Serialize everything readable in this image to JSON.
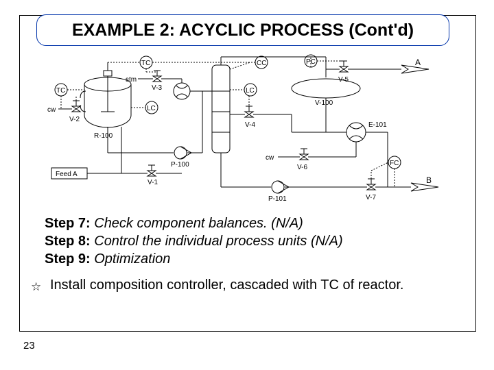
{
  "title": "EXAMPLE 2: ACYCLIC PROCESS (Cont'd)",
  "diagram": {
    "reactor": "R-100",
    "pump1": "P-100",
    "pump2": "P-101",
    "exchanger": "E-101",
    "valves": [
      "V-1",
      "V-2",
      "V-3",
      "V-4",
      "V-5",
      "V-6",
      "V-7",
      "V-100"
    ],
    "controllers": [
      "TC",
      "TC",
      "LC",
      "LC",
      "PC",
      "CC",
      "FC"
    ],
    "streams": [
      "Feed A",
      "cw",
      "stm",
      "cw",
      "A",
      "B"
    ],
    "product_A": "A",
    "product_B": "B",
    "feed": "Feed A",
    "cw": "cw",
    "stm": "stm"
  },
  "steps": {
    "s7_label": "Step 7:",
    "s7_text": " Check component balances. (N/A)",
    "s8_label": "Step 8:",
    "s8_text": " Control the individual process units (N/A)",
    "s9_label": "Step 9:",
    "s9_text_i": " Optimization"
  },
  "bullet": "Install composition controller, cascaded with TC of reactor.",
  "page": "23"
}
